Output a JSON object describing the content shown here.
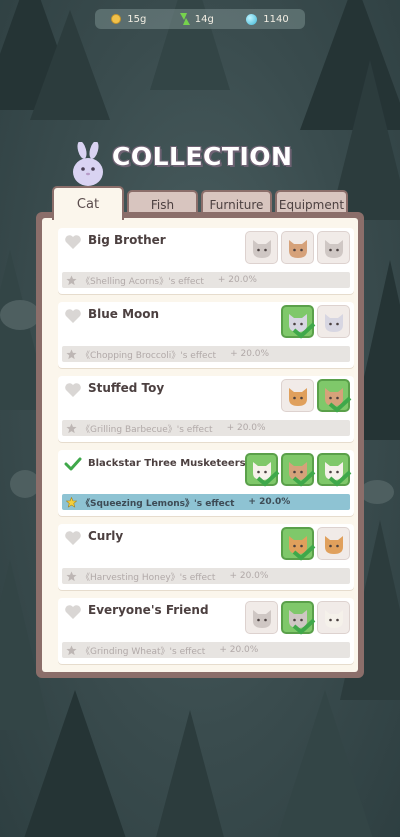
{
  "resources": {
    "coins": "15g",
    "energy": "14g",
    "gems": "1140",
    "coin_icon": "coin-icon",
    "energy_icon": "lightning-icon",
    "gem_icon": "gem-icon"
  },
  "title": "COLLECTION",
  "tabs": [
    "Cat",
    "Fish",
    "Furniture",
    "Equipment"
  ],
  "active_tab": "Cat",
  "colors": {
    "panel_border": "#8b6e6a",
    "owned_green": "#7fc86a",
    "active_effect": "#8ec3d3",
    "heart_active": "#3fa84a"
  },
  "collections": [
    {
      "name": "Big Brother",
      "effect": "《Shelling Acorns》's effect",
      "bonus": "+ 20.0%",
      "active": false,
      "cats": [
        {
          "fur": "grey",
          "owned": false
        },
        {
          "fur": "tan",
          "owned": false
        },
        {
          "fur": "grey",
          "owned": false
        }
      ]
    },
    {
      "name": "Blue Moon",
      "effect": "《Chopping Broccoli》's effect",
      "bonus": "+ 20.0%",
      "active": false,
      "cats": [
        {
          "fur": "silver",
          "owned": true
        },
        {
          "fur": "silver",
          "owned": false
        }
      ]
    },
    {
      "name": "Stuffed Toy",
      "effect": "《Grilling Barbecue》's effect",
      "bonus": "+ 20.0%",
      "active": false,
      "cats": [
        {
          "fur": "orange",
          "owned": false
        },
        {
          "fur": "tan",
          "owned": true
        }
      ]
    },
    {
      "name": "Blackstar Three Musketeers",
      "effect": "《Squeezing Lemons》's effect",
      "bonus": "+ 20.0%",
      "active": true,
      "cats": [
        {
          "fur": "white",
          "owned": true
        },
        {
          "fur": "tan",
          "owned": true
        },
        {
          "fur": "white",
          "owned": true
        }
      ]
    },
    {
      "name": "Curly",
      "effect": "《Harvesting Honey》's effect",
      "bonus": "+ 20.0%",
      "active": false,
      "cats": [
        {
          "fur": "orange",
          "owned": true
        },
        {
          "fur": "orange",
          "owned": false
        }
      ]
    },
    {
      "name": "Everyone's Friend",
      "effect": "《Grinding Wheat》's effect",
      "bonus": "+ 20.0%",
      "active": false,
      "cats": [
        {
          "fur": "grey",
          "owned": false
        },
        {
          "fur": "grey",
          "owned": true
        },
        {
          "fur": "white",
          "owned": false
        }
      ]
    }
  ]
}
